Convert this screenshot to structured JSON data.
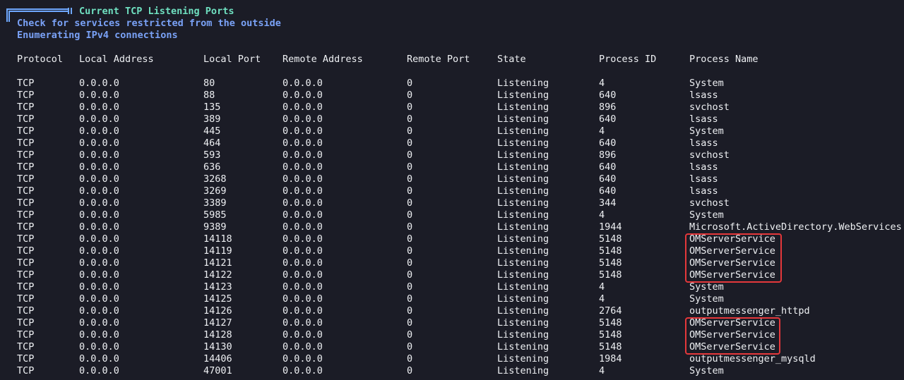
{
  "section": {
    "title": "Current TCP Listening Ports",
    "notes": [
      "Check for services restricted from the outside",
      "Enumerating IPv4 connections"
    ]
  },
  "colors": {
    "background": "#1b1c26",
    "title": "#6fe0c0",
    "info": "#7aa2f7",
    "text": "#eef0f3",
    "highlight": "#e5383b"
  },
  "table": {
    "headers": [
      "Protocol",
      "Local Address",
      "Local Port",
      "Remote Address",
      "Remote Port",
      "State",
      "Process ID",
      "Process Name"
    ],
    "rows": [
      [
        "TCP",
        "0.0.0.0",
        "80",
        "0.0.0.0",
        "0",
        "Listening",
        "4",
        "System"
      ],
      [
        "TCP",
        "0.0.0.0",
        "88",
        "0.0.0.0",
        "0",
        "Listening",
        "640",
        "lsass"
      ],
      [
        "TCP",
        "0.0.0.0",
        "135",
        "0.0.0.0",
        "0",
        "Listening",
        "896",
        "svchost"
      ],
      [
        "TCP",
        "0.0.0.0",
        "389",
        "0.0.0.0",
        "0",
        "Listening",
        "640",
        "lsass"
      ],
      [
        "TCP",
        "0.0.0.0",
        "445",
        "0.0.0.0",
        "0",
        "Listening",
        "4",
        "System"
      ],
      [
        "TCP",
        "0.0.0.0",
        "464",
        "0.0.0.0",
        "0",
        "Listening",
        "640",
        "lsass"
      ],
      [
        "TCP",
        "0.0.0.0",
        "593",
        "0.0.0.0",
        "0",
        "Listening",
        "896",
        "svchost"
      ],
      [
        "TCP",
        "0.0.0.0",
        "636",
        "0.0.0.0",
        "0",
        "Listening",
        "640",
        "lsass"
      ],
      [
        "TCP",
        "0.0.0.0",
        "3268",
        "0.0.0.0",
        "0",
        "Listening",
        "640",
        "lsass"
      ],
      [
        "TCP",
        "0.0.0.0",
        "3269",
        "0.0.0.0",
        "0",
        "Listening",
        "640",
        "lsass"
      ],
      [
        "TCP",
        "0.0.0.0",
        "3389",
        "0.0.0.0",
        "0",
        "Listening",
        "344",
        "svchost"
      ],
      [
        "TCP",
        "0.0.0.0",
        "5985",
        "0.0.0.0",
        "0",
        "Listening",
        "4",
        "System"
      ],
      [
        "TCP",
        "0.0.0.0",
        "9389",
        "0.0.0.0",
        "0",
        "Listening",
        "1944",
        "Microsoft.ActiveDirectory.WebServices"
      ],
      [
        "TCP",
        "0.0.0.0",
        "14118",
        "0.0.0.0",
        "0",
        "Listening",
        "5148",
        "OMServerService"
      ],
      [
        "TCP",
        "0.0.0.0",
        "14119",
        "0.0.0.0",
        "0",
        "Listening",
        "5148",
        "OMServerService"
      ],
      [
        "TCP",
        "0.0.0.0",
        "14121",
        "0.0.0.0",
        "0",
        "Listening",
        "5148",
        "OMServerService"
      ],
      [
        "TCP",
        "0.0.0.0",
        "14122",
        "0.0.0.0",
        "0",
        "Listening",
        "5148",
        "OMServerService"
      ],
      [
        "TCP",
        "0.0.0.0",
        "14123",
        "0.0.0.0",
        "0",
        "Listening",
        "4",
        "System"
      ],
      [
        "TCP",
        "0.0.0.0",
        "14125",
        "0.0.0.0",
        "0",
        "Listening",
        "4",
        "System"
      ],
      [
        "TCP",
        "0.0.0.0",
        "14126",
        "0.0.0.0",
        "0",
        "Listening",
        "2764",
        "outputmessenger_httpd"
      ],
      [
        "TCP",
        "0.0.0.0",
        "14127",
        "0.0.0.0",
        "0",
        "Listening",
        "5148",
        "OMServerService"
      ],
      [
        "TCP",
        "0.0.0.0",
        "14128",
        "0.0.0.0",
        "0",
        "Listening",
        "5148",
        "OMServerService"
      ],
      [
        "TCP",
        "0.0.0.0",
        "14130",
        "0.0.0.0",
        "0",
        "Listening",
        "5148",
        "OMServerService"
      ],
      [
        "TCP",
        "0.0.0.0",
        "14406",
        "0.0.0.0",
        "0",
        "Listening",
        "1984",
        "outputmessenger_mysqld"
      ],
      [
        "TCP",
        "0.0.0.0",
        "47001",
        "0.0.0.0",
        "0",
        "Listening",
        "4",
        "System"
      ]
    ]
  }
}
